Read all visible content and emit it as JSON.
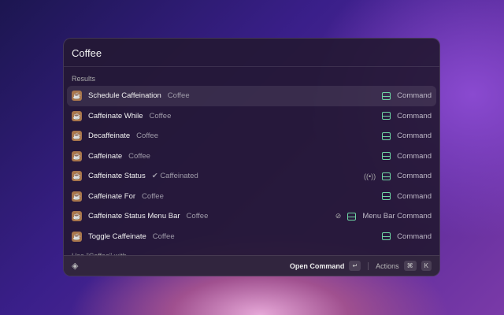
{
  "search": {
    "query": "Coffee"
  },
  "section_title": "Results",
  "results": [
    {
      "title": "Schedule Caffeination",
      "subtitle": "Coffee",
      "type": "Command",
      "selected": true
    },
    {
      "title": "Caffeinate While",
      "subtitle": "Coffee",
      "type": "Command"
    },
    {
      "title": "Decaffeinate",
      "subtitle": "Coffee",
      "type": "Command"
    },
    {
      "title": "Caffeinate",
      "subtitle": "Coffee",
      "type": "Command"
    },
    {
      "title": "Caffeinate Status",
      "subtitle": "✔ Caffeinated",
      "type": "Command",
      "accessory": "((•))"
    },
    {
      "title": "Caffeinate For",
      "subtitle": "Coffee",
      "type": "Command"
    },
    {
      "title": "Caffeinate Status Menu Bar",
      "subtitle": "Coffee",
      "type": "Menu Bar Command",
      "accessory": "⊘"
    },
    {
      "title": "Toggle Caffeinate",
      "subtitle": "Coffee",
      "type": "Command"
    }
  ],
  "fallback": "Use \"Coffee\" with...",
  "footer": {
    "primary_action": "Open Command",
    "primary_key": "↵",
    "actions_label": "Actions",
    "actions_keys": [
      "⌘",
      "K"
    ]
  }
}
